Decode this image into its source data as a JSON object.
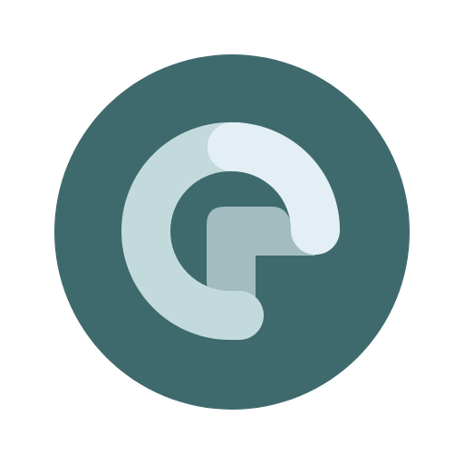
{
  "logo": {
    "name": "circular-app-logo",
    "colors": {
      "background": "#ffffff",
      "circle": "#3f6a6d",
      "outer_arc": "#c3dadc",
      "top_arc": "#e3eff5",
      "inner_square": "#a2bcc0"
    }
  }
}
